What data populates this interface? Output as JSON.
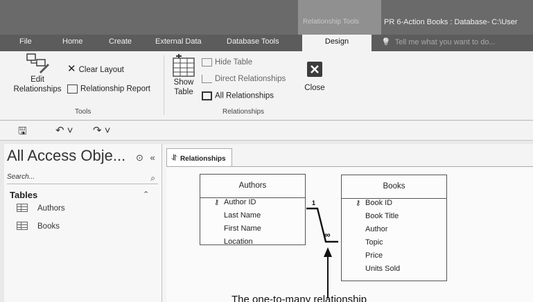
{
  "titlebar": {
    "context_label": "Relationship Tools",
    "document_title": "PR 6-Action Books : Database- C:\\User"
  },
  "tabs": [
    "File",
    "Home",
    "Create",
    "External Data",
    "Database Tools",
    "Design"
  ],
  "active_tab": "Design",
  "tell_me": "Tell me what you want to do...",
  "ribbon": {
    "tools": {
      "edit_relationships": "Edit\nRelationships",
      "clear_layout": "Clear Layout",
      "relationship_report": "Relationship Report",
      "group_label": "Tools"
    },
    "relationships": {
      "show_table": "Show\nTable",
      "hide_table": "Hide Table",
      "direct_relationships": "Direct Relationships",
      "all_relationships": "All Relationships",
      "close": "Close",
      "group_label": "Relationships"
    }
  },
  "nav": {
    "title": "All Access Obje...",
    "search_placeholder": "Search...",
    "section": "Tables",
    "items": [
      "Authors",
      "Books"
    ]
  },
  "document": {
    "tab_label": "Relationships",
    "tables": [
      {
        "name": "Authors",
        "fields": [
          "Author ID",
          "Last Name",
          "First Name",
          "Location"
        ],
        "key_field": "Author ID"
      },
      {
        "name": "Books",
        "fields": [
          "Book ID",
          "Book Title",
          "Author",
          "Topic",
          "Price",
          "Units Sold"
        ],
        "key_field": "Book ID"
      }
    ],
    "relationship": {
      "one_side": "1",
      "many_side": "∞"
    }
  },
  "annotation": "The one-to-many relationship",
  "icons": [
    "edit-relationships-icon",
    "clear-layout-icon",
    "relationship-report-icon",
    "show-table-icon",
    "hide-table-icon",
    "direct-relationships-icon",
    "all-relationships-icon",
    "close-icon",
    "save-icon",
    "undo-icon",
    "redo-icon",
    "search-icon",
    "table-icon",
    "key-icon",
    "relationships-tab-icon"
  ]
}
